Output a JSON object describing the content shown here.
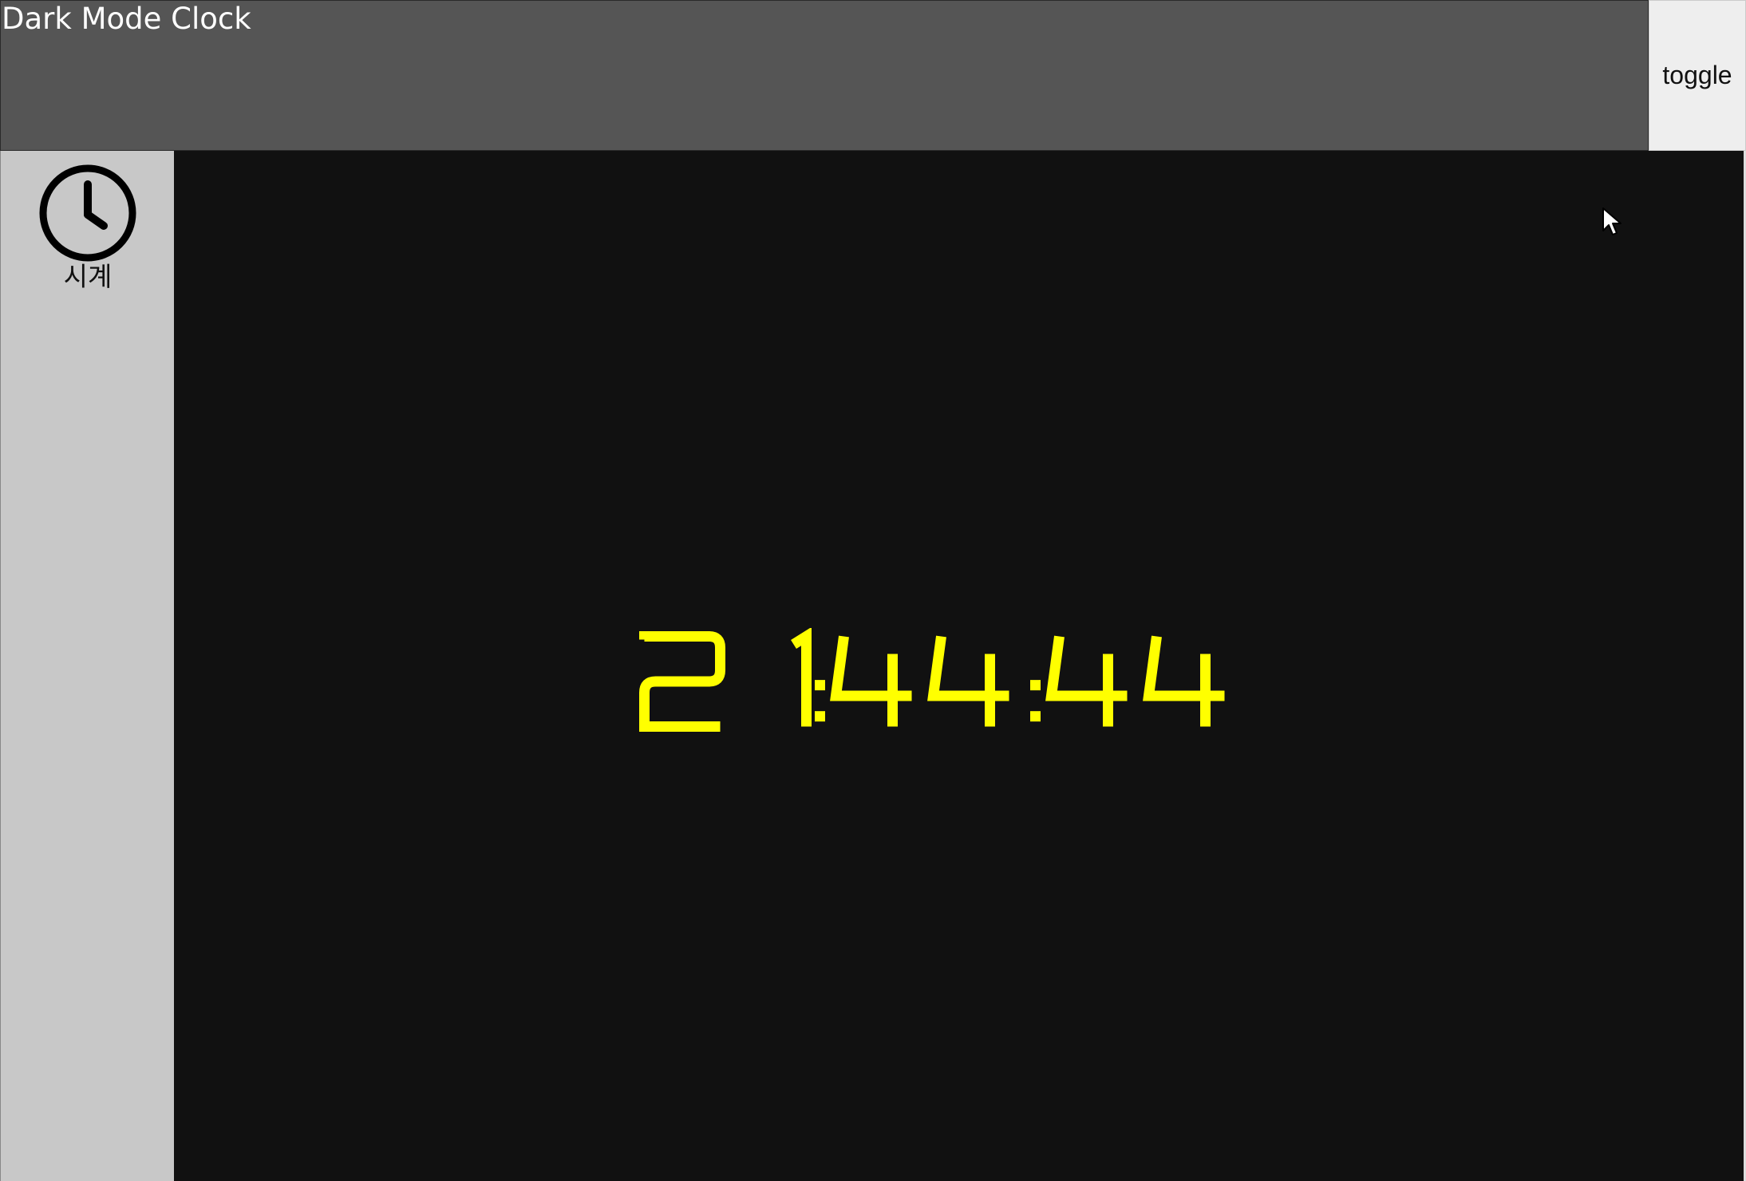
{
  "window": {
    "title": "Dark Mode Clock"
  },
  "toolbar": {
    "toggle_label": "toggle"
  },
  "sidebar": {
    "items": [
      {
        "label": "시계",
        "icon": "clock-icon"
      }
    ]
  },
  "clock": {
    "time": "21:44:44",
    "color": "#ffff00"
  },
  "colors": {
    "header_bg": "#555555",
    "sidebar_bg": "#c8c8c8",
    "main_bg": "#111111",
    "toggle_bg": "#eeeeee"
  }
}
